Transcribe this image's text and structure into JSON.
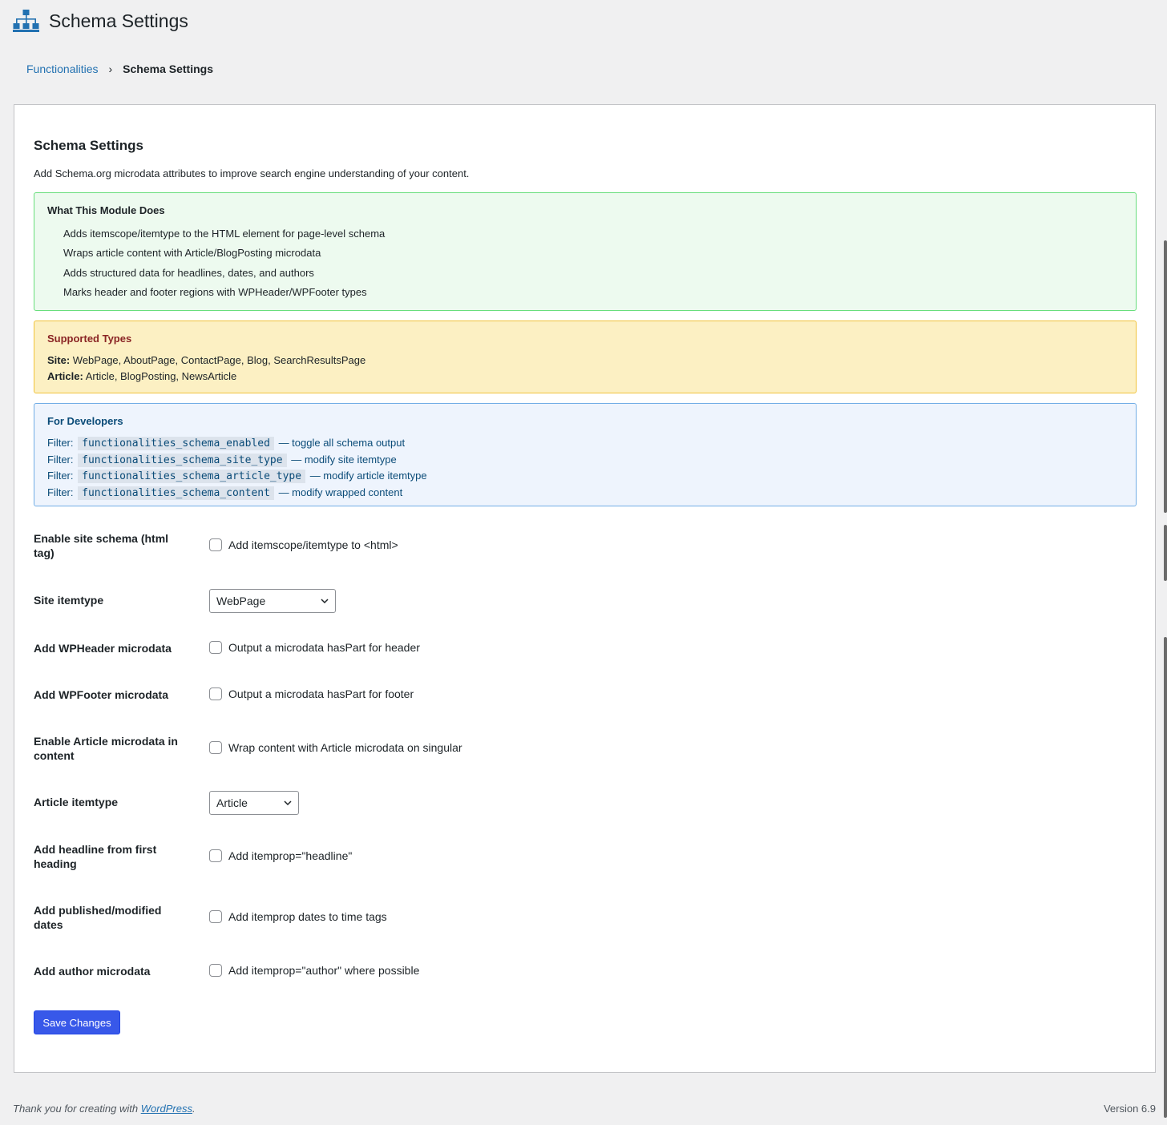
{
  "header": {
    "title": "Schema Settings",
    "icon": "sitemap-icon"
  },
  "breadcrumb": {
    "parent": "Functionalities",
    "separator": "›",
    "current": "Schema Settings"
  },
  "card": {
    "title": "Schema Settings",
    "description": "Add Schema.org microdata attributes to improve search engine understanding of your content."
  },
  "module_box": {
    "heading": "What This Module Does",
    "items": [
      "Adds itemscope/itemtype to the HTML element for page-level schema",
      "Wraps article content with Article/BlogPosting microdata",
      "Adds structured data for headlines, dates, and authors",
      "Marks header and footer regions with WPHeader/WPFooter types"
    ]
  },
  "types_box": {
    "heading": "Supported Types",
    "site_label": "Site:",
    "site_types": "WebPage, AboutPage, ContactPage, Blog, SearchResultsPage",
    "article_label": "Article:",
    "article_types": "Article, BlogPosting, NewsArticle"
  },
  "dev_box": {
    "heading": "For Developers",
    "filters": [
      {
        "prefix": "Filter:",
        "code": "functionalities_schema_enabled",
        "desc": "— toggle all schema output"
      },
      {
        "prefix": "Filter:",
        "code": "functionalities_schema_site_type",
        "desc": "— modify site itemtype"
      },
      {
        "prefix": "Filter:",
        "code": "functionalities_schema_article_type",
        "desc": "— modify article itemtype"
      },
      {
        "prefix": "Filter:",
        "code": "functionalities_schema_content",
        "desc": "— modify wrapped content"
      }
    ]
  },
  "settings": {
    "enable_site": {
      "label": "Enable site schema (html tag)",
      "option": "Add itemscope/itemtype to <html>",
      "checked": false
    },
    "site_itemtype": {
      "label": "Site itemtype",
      "value": "WebPage"
    },
    "wpheader": {
      "label": "Add WPHeader microdata",
      "option": "Output a microdata hasPart for header",
      "checked": false
    },
    "wpfooter": {
      "label": "Add WPFooter microdata",
      "option": "Output a microdata hasPart for footer",
      "checked": false
    },
    "article_microdata": {
      "label": "Enable Article microdata in content",
      "option": "Wrap content with Article microdata on singular",
      "checked": false
    },
    "article_itemtype": {
      "label": "Article itemtype",
      "value": "Article"
    },
    "headline": {
      "label": "Add headline from first heading",
      "option": "Add itemprop=\"headline\"",
      "checked": false
    },
    "dates": {
      "label": "Add published/modified dates",
      "option": "Add itemprop dates to time tags",
      "checked": false
    },
    "author": {
      "label": "Add author microdata",
      "option": "Add itemprop=\"author\" where possible",
      "checked": false
    }
  },
  "save_label": "Save Changes",
  "footer": {
    "thanks_prefix": "Thank you for creating with ",
    "thanks_link": "WordPress",
    "thanks_suffix": ".",
    "version": "Version 6.9"
  },
  "colors": {
    "accent": "#3858e9",
    "link": "#2271b1"
  }
}
